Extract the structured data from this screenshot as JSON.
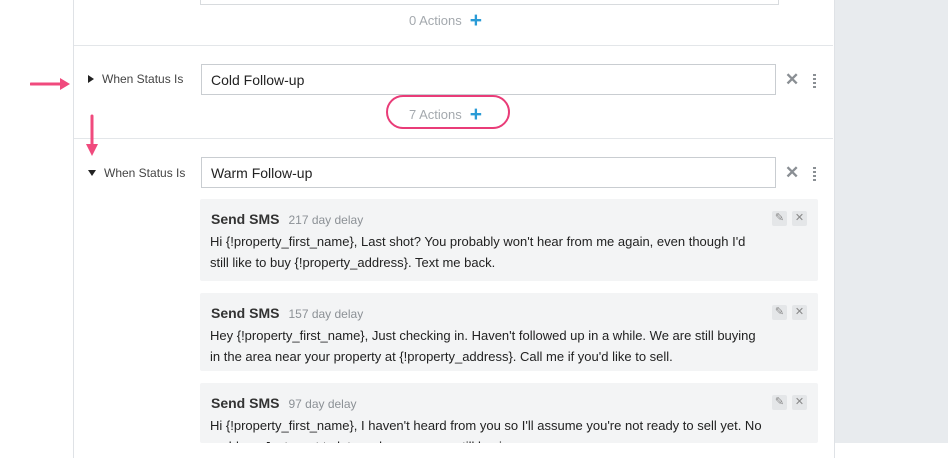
{
  "top_rule": {
    "actions_label": "0 Actions"
  },
  "rules": [
    {
      "label": "When Status Is",
      "status_value": "Cold Follow-up",
      "expanded": false,
      "actions_label": "7 Actions"
    },
    {
      "label": "When Status Is",
      "status_value": "Warm Follow-up",
      "expanded": true
    }
  ],
  "actions": [
    {
      "type": "Send SMS",
      "delay": "217 day delay",
      "message": "Hi {!property_first_name}, Last shot? You probably won't hear from me again, even though I'd still like to buy {!property_address}. Text me back."
    },
    {
      "type": "Send SMS",
      "delay": "157 day delay",
      "message": "Hey {!property_first_name}, Just checking in. Haven't followed up in a while. We are still buying in the area near your property at {!property_address}. Call me if you'd like to sell."
    },
    {
      "type": "Send SMS",
      "delay": "97 day delay",
      "message": "Hi {!property_first_name}, I haven't heard from you so I'll assume you're not ready to sell yet. No problem. Just want to let you know we are still buying."
    }
  ],
  "icons": {
    "add": "plus-icon",
    "remove": "close-icon",
    "menu": "drag-handle-icon",
    "edit": "pencil-icon",
    "collapsed": "caret-right-icon",
    "expanded": "caret-down-icon"
  },
  "colors": {
    "accent": "#2a9bd6",
    "highlight": "#e93c78",
    "panel": "#e8ebee",
    "card": "#f3f4f5"
  }
}
